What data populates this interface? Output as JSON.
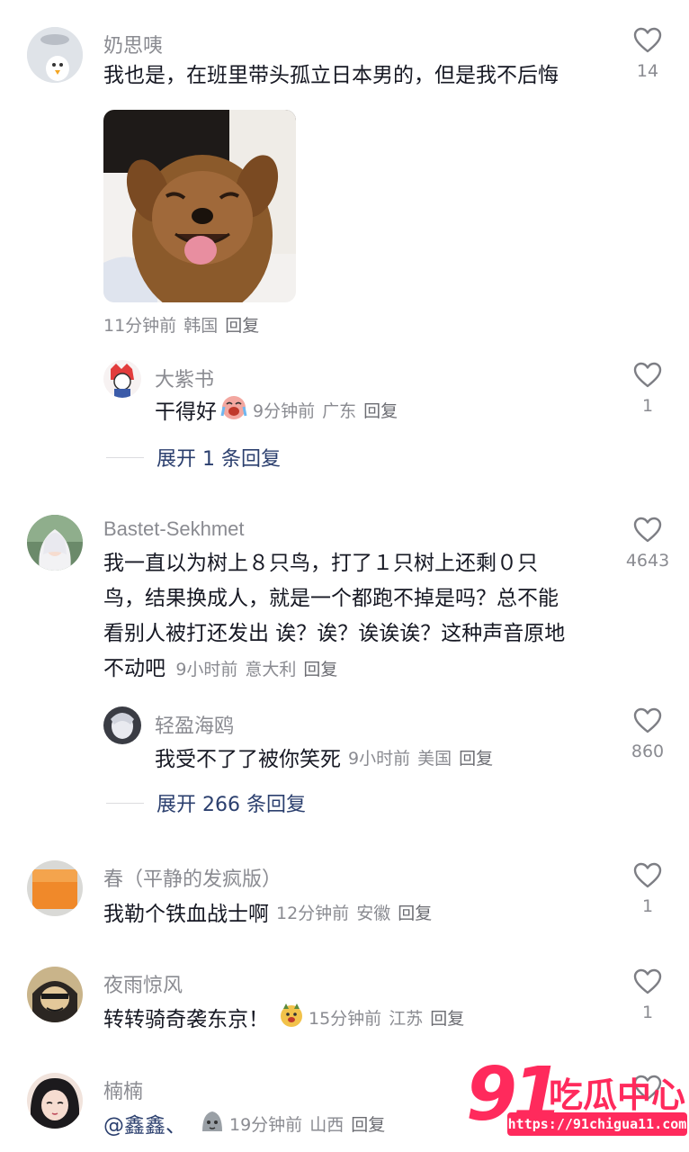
{
  "comments": [
    {
      "username": "奶思咦",
      "text": "我也是，在班里带头孤立日本男的，但是我不后悔",
      "time": "11分钟前",
      "location": "韩国",
      "reply_label": "回复",
      "likes": "14",
      "image": "smiling-dog-photo",
      "replies": [
        {
          "username": "大紫书",
          "text": "干得好",
          "emoji": "crying-laughing-emoji",
          "time": "9分钟前",
          "location": "广东",
          "reply_label": "回复",
          "likes": "1"
        }
      ],
      "expand_label": "展开 1 条回复"
    },
    {
      "username": "Bastet-Sekhmet",
      "text_lines": [
        "我一直以为树上８只鸟，打了１只树上还剩０只",
        "鸟，结果换成人，就是一个都跑不掉是吗？总不能",
        "看别人被打还发出 诶？诶？诶诶诶？这种声音原地",
        "不动吧"
      ],
      "time": "9小时前",
      "location": "意大利",
      "reply_label": "回复",
      "likes": "4643",
      "replies": [
        {
          "username": "轻盈海鸥",
          "text": "我受不了了被你笑死",
          "time": "9小时前",
          "location": "美国",
          "reply_label": "回复",
          "likes": "860"
        }
      ],
      "expand_label": "展开 266 条回复"
    },
    {
      "username": "春（平静的发疯版）",
      "text": "我勒个铁血战士啊",
      "time": "12分钟前",
      "location": "安徽",
      "reply_label": "回复",
      "likes": "1"
    },
    {
      "username": "夜雨惊风",
      "text": "转转骑奇袭东京！",
      "emoji": "doge-emoji",
      "time": "15分钟前",
      "location": "江苏",
      "reply_label": "回复",
      "likes": "1"
    },
    {
      "username": "楠楠",
      "text": "@鑫鑫、",
      "emoji": "grey-blob-emoji",
      "time": "19分钟前",
      "location": "山西",
      "reply_label": "回复"
    }
  ],
  "watermark": {
    "number": "91",
    "name": "吃瓜中心",
    "url": "https://91chigua11.com"
  },
  "colors": {
    "username": "#8a8b91",
    "text": "#161823",
    "expand": "#2b3f6e",
    "watermark": "#ff2a5c"
  }
}
